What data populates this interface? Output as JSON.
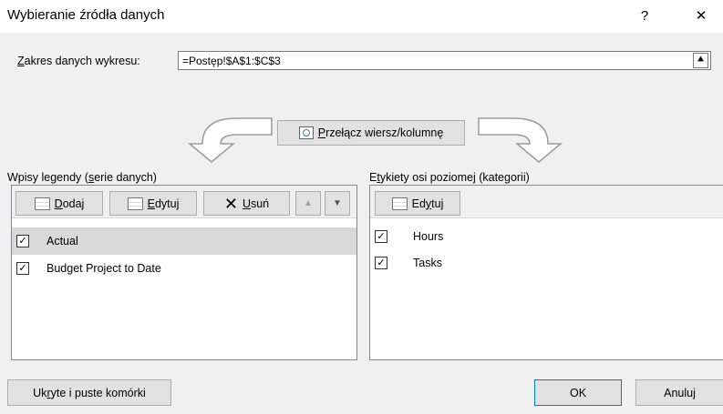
{
  "window": {
    "title": "Wybieranie źródła danych",
    "help_label": "?",
    "close_label": "✕"
  },
  "range": {
    "label_prefix": "",
    "label_u": "Z",
    "label_rest": "akres danych wykresu:",
    "value": "=Postęp!$A$1:$C$3",
    "collapse_label": "⯅"
  },
  "switch_button": {
    "label_u": "P",
    "label_rest": "rzełącz wiersz/kolumnę"
  },
  "legend": {
    "header_pre": "Wpisy legendy (",
    "header_u": "s",
    "header_post": "erie danych)",
    "add_u": "D",
    "add_rest": "odaj",
    "edit_u": "E",
    "edit_rest": "dytuj",
    "remove_u": "U",
    "remove_rest": "suń",
    "up_label": "▲",
    "down_label": "▼",
    "items": [
      {
        "label": "Actual",
        "checked": "✓",
        "selected": true
      },
      {
        "label": "Budget Project to Date",
        "checked": "✓",
        "selected": false
      }
    ]
  },
  "axis": {
    "header_pre": "E",
    "header_u": "t",
    "header_post": "ykiety osi poziomej (kategorii)",
    "edit_pre": "Ed",
    "edit_u": "y",
    "edit_post": "tuj",
    "items": [
      {
        "label": "Hours",
        "checked": "✓"
      },
      {
        "label": "Tasks",
        "checked": "✓"
      }
    ]
  },
  "footer": {
    "hidden_pre": "Uk",
    "hidden_u": "r",
    "hidden_post": "yte i puste komórki",
    "ok_label": "OK",
    "cancel_label": "Anuluj"
  },
  "colors": {
    "selected_row": "#d9d9d9",
    "primary_border": "#0078d7"
  }
}
